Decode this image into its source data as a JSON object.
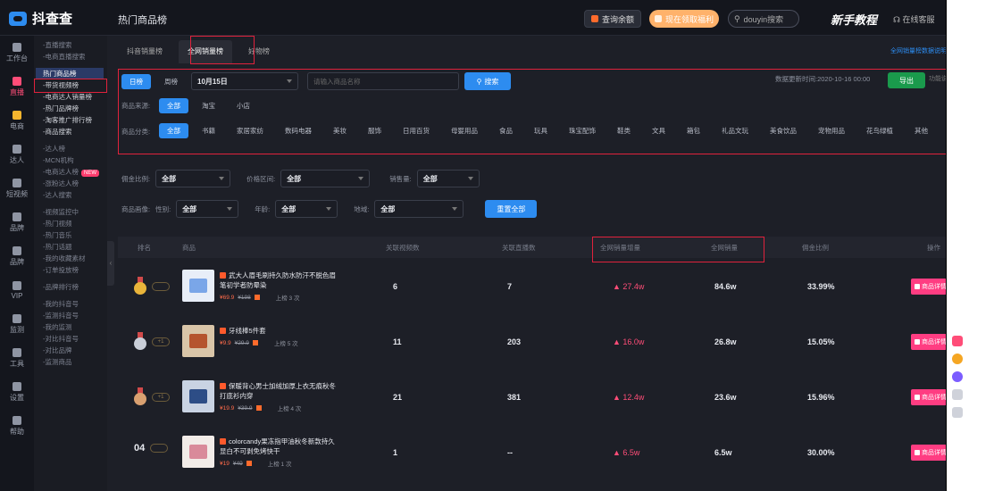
{
  "app": {
    "logo_text": "抖查查",
    "page_title": "热门商品榜"
  },
  "topbar": {
    "recharge_label": "查询余额",
    "promo_label": "现在领取福利",
    "search_placeholder": "douyin搜索",
    "tutorial_label": "新手教程",
    "service_label": "在线客服"
  },
  "sidebar": [
    {
      "label": "工作台",
      "icon": "grid-icon"
    },
    {
      "label": "直播",
      "icon": "live-icon",
      "active": true
    },
    {
      "label": "电商",
      "icon": "shop-icon",
      "gold": true
    },
    {
      "label": "达人",
      "icon": "tiktok-icon"
    },
    {
      "label": "短视频",
      "icon": "video-icon"
    },
    {
      "label": "品牌",
      "icon": "brand-icon"
    },
    {
      "label": "品牌",
      "icon": "store-icon"
    },
    {
      "label": "VIP",
      "icon": "crown-icon"
    },
    {
      "label": "监测",
      "icon": "monitor-icon"
    },
    {
      "label": "工具",
      "icon": "tool-icon"
    },
    {
      "label": "设置",
      "icon": "settings-icon"
    },
    {
      "label": "帮助",
      "icon": "help-icon"
    }
  ],
  "submenu": [
    {
      "label": "-直播搜索",
      "cls": ""
    },
    {
      "label": "-电商直播搜索",
      "cls": ""
    },
    {
      "label": "热门商品榜",
      "cls": "current gap"
    },
    {
      "label": "-带货视频榜",
      "cls": "bright"
    },
    {
      "label": "-电商达人销量榜",
      "cls": "bright"
    },
    {
      "label": "-热门品牌榜",
      "cls": "bright"
    },
    {
      "label": "-淘客推广排行榜",
      "cls": "bright"
    },
    {
      "label": "-商品搜索",
      "cls": "bright"
    },
    {
      "label": "-达人榜",
      "cls": "gap"
    },
    {
      "label": "-MCN机构",
      "cls": ""
    },
    {
      "label": "-电商达人榜",
      "cls": "",
      "badge": "NEW"
    },
    {
      "label": "-涨粉达人榜",
      "cls": ""
    },
    {
      "label": "-达人搜索",
      "cls": ""
    },
    {
      "label": "-视频监控中",
      "cls": "gap"
    },
    {
      "label": "-热门视频",
      "cls": ""
    },
    {
      "label": "-热门音乐",
      "cls": ""
    },
    {
      "label": "-热门话题",
      "cls": ""
    },
    {
      "label": "-我的收藏素材",
      "cls": ""
    },
    {
      "label": "-订单投放榜",
      "cls": ""
    },
    {
      "label": "-品牌排行榜",
      "cls": "gap"
    },
    {
      "label": "-我的抖音号",
      "cls": "gap"
    },
    {
      "label": "-监测抖音号",
      "cls": ""
    },
    {
      "label": "-我的监测",
      "cls": ""
    },
    {
      "label": "-对比抖音号",
      "cls": ""
    },
    {
      "label": "-对比品牌",
      "cls": ""
    },
    {
      "label": "-监测商品",
      "cls": ""
    }
  ],
  "tabs": [
    {
      "label": "抖音销量榜",
      "active": false
    },
    {
      "label": "全网销量榜",
      "active": true
    },
    {
      "label": "好物榜",
      "active": false
    }
  ],
  "tab_right_link": "全网销量榜数据说明",
  "filters": {
    "period_day": "日榜",
    "period_week": "周榜",
    "date_value": "10月15日",
    "keyword_placeholder": "请输入商品名称",
    "search_btn": "搜索",
    "update_time": "数据更新时间:2020-10-16 00:00",
    "export_btn": "导出",
    "help_link": "功能说明",
    "source_label": "商品来源:",
    "source_options": [
      "全部",
      "淘宝",
      "小店"
    ],
    "category_label": "商品分类:",
    "categories": [
      "全部",
      "书籍",
      "家居家纺",
      "数码电器",
      "美妆",
      "服饰",
      "日用百货",
      "母婴用品",
      "食品",
      "玩具",
      "珠宝配饰",
      "鞋类",
      "文具",
      "箱包",
      "礼品文玩",
      "美食饮品",
      "宠物用品",
      "花鸟绿植",
      "其他"
    ],
    "commission_label": "佣金比例:",
    "commission_value": "全部",
    "price_label": "价格区间:",
    "price_value": "全部",
    "sales_label": "销售量:",
    "sales_value": "全部",
    "persona_label": "商品画像:",
    "gender_label": "性别:",
    "gender_value": "全部",
    "age_label": "年龄:",
    "age_value": "全部",
    "region_label": "地域:",
    "region_value": "全部",
    "reset_btn": "重置全部"
  },
  "table": {
    "headers": [
      "排名",
      "商品",
      "关联视频数",
      "关联直播数",
      "全网销量增量",
      "全网销量",
      "佣金比例",
      "操作"
    ],
    "detail_btn": "商品详情",
    "rows": [
      {
        "rank_type": "gold",
        "rank_label": "",
        "rank_pill": "",
        "name": "武大人眉毛刷持久防水防汗不脱色眉笔初学者防晕染",
        "price": "¥69.9",
        "orig_price": "¥198",
        "listed": "上榜 3 次",
        "videos": "6",
        "lives": "7",
        "sales_inc": "▲ 27.4w",
        "sales_total": "84.6w",
        "commission": "33.99%",
        "thumb": "#e8eef8",
        "thumb_accent": "#7aa6e8"
      },
      {
        "rank_type": "silver",
        "rank_label": "",
        "rank_pill": "+1",
        "name": "牙线棒5件套",
        "price": "¥9.9",
        "orig_price": "¥29.9",
        "listed": "上榜 5 次",
        "videos": "11",
        "lives": "203",
        "sales_inc": "▲ 16.0w",
        "sales_total": "26.8w",
        "commission": "15.05%",
        "thumb": "#d9c5a8",
        "thumb_accent": "#b5542e"
      },
      {
        "rank_type": "bronze",
        "rank_label": "",
        "rank_pill": "+1",
        "name": "保暖背心男士加绒加厚上衣无痕秋冬打底衫内穿",
        "price": "¥19.9",
        "orig_price": "¥39.9",
        "listed": "上榜 4 次",
        "videos": "21",
        "lives": "381",
        "sales_inc": "▲ 12.4w",
        "sales_total": "23.6w",
        "commission": "15.96%",
        "thumb": "#c9d3e3",
        "thumb_accent": "#2d4d86"
      },
      {
        "rank_type": "num",
        "rank_label": "04",
        "rank_pill": "",
        "name": "colorcandy果冻指甲油秋冬新款持久显白不可剥免烤快干",
        "price": "¥19",
        "orig_price": "¥49",
        "listed": "上榜 1 次",
        "videos": "1",
        "lives": "--",
        "sales_inc": "▲ 6.5w",
        "sales_total": "6.5w",
        "commission": "30.00%",
        "thumb": "#f2ece8",
        "thumb_accent": "#d98a9a"
      }
    ]
  },
  "colors": {
    "accent_blue": "#2d8cf0",
    "accent_pink": "#ff3d82",
    "highlight_red": "#e0223c",
    "bg_dark": "#1d1f27"
  }
}
